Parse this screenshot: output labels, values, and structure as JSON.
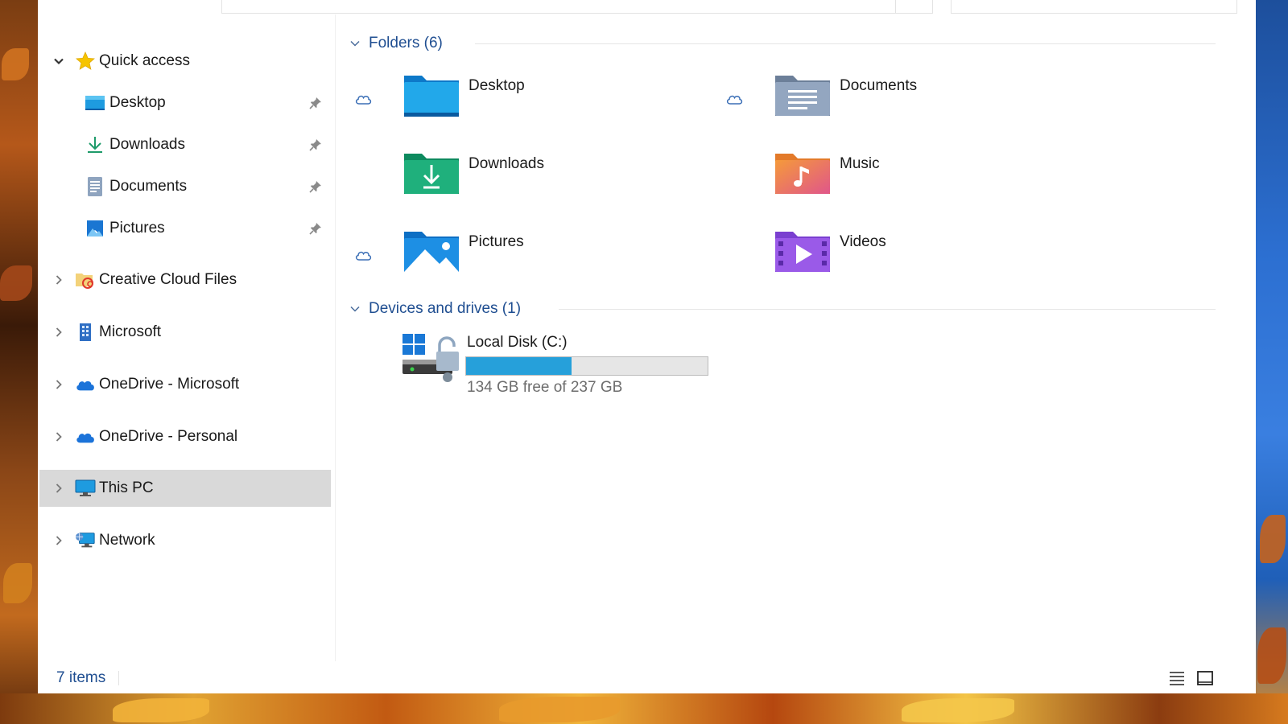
{
  "nav": {
    "items": [
      {
        "label": "Quick access",
        "icon": "star-icon",
        "expanded": true,
        "pinned": false
      },
      {
        "label": "Desktop",
        "icon": "desktop-folder-icon",
        "pinned": true
      },
      {
        "label": "Downloads",
        "icon": "download-arrow-icon",
        "pinned": true
      },
      {
        "label": "Documents",
        "icon": "document-icon",
        "pinned": true
      },
      {
        "label": "Pictures",
        "icon": "pictures-bookmark-icon",
        "pinned": true
      },
      {
        "label": "Creative Cloud Files",
        "icon": "creative-cloud-folder-icon"
      },
      {
        "label": "Microsoft",
        "icon": "building-icon"
      },
      {
        "label": "OneDrive - Microsoft",
        "icon": "onedrive-cloud-icon"
      },
      {
        "label": "OneDrive - Personal",
        "icon": "onedrive-cloud-icon"
      },
      {
        "label": "This PC",
        "icon": "monitor-icon",
        "selected": true
      },
      {
        "label": "Network",
        "icon": "network-icon"
      }
    ]
  },
  "content": {
    "folders_heading": "Folders (6)",
    "folders": [
      {
        "name": "Desktop",
        "icon": "desktop-folder-icon",
        "cloud": true
      },
      {
        "name": "Documents",
        "icon": "documents-folder-icon",
        "cloud": true
      },
      {
        "name": "Downloads",
        "icon": "downloads-folder-icon",
        "cloud": false
      },
      {
        "name": "Music",
        "icon": "music-folder-icon",
        "cloud": false
      },
      {
        "name": "Pictures",
        "icon": "pictures-folder-icon",
        "cloud": true
      },
      {
        "name": "Videos",
        "icon": "videos-folder-icon",
        "cloud": false
      }
    ],
    "drives_heading": "Devices and drives (1)",
    "drive": {
      "name": "Local Disk (C:)",
      "free_text": "134 GB free of 237 GB",
      "used_fraction": 0.435
    }
  },
  "status": {
    "item_count": "7 items"
  },
  "colors": {
    "accent_text": "#1f4e91",
    "selection": "#d9d9d9",
    "drive_bar": "#26a0da"
  }
}
